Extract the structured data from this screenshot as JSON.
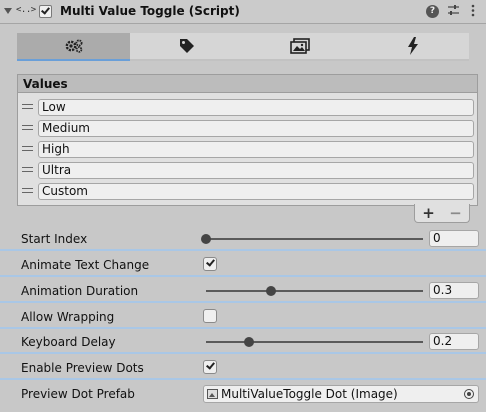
{
  "component": {
    "title": "Multi Value Toggle (Script)",
    "script_icon_text": "<..>",
    "enabled": true,
    "icons": {
      "help": "help-icon",
      "presets": "presets-icon",
      "menu": "kebab-menu-icon"
    }
  },
  "tabs": [
    {
      "icon": "gears-icon",
      "active": true
    },
    {
      "icon": "tag-icon",
      "active": false
    },
    {
      "icon": "images-icon",
      "active": false
    },
    {
      "icon": "lightning-icon",
      "active": false
    }
  ],
  "values_list": {
    "header": "Values",
    "items": [
      "Low",
      "Medium",
      "High",
      "Ultra",
      "Custom"
    ],
    "add_label": "+",
    "remove_label": "−"
  },
  "properties": {
    "start_index": {
      "label": "Start Index",
      "value": "0",
      "slider_fraction": 0.0
    },
    "animate_text_change": {
      "label": "Animate Text Change",
      "checked": true
    },
    "animation_duration": {
      "label": "Animation Duration",
      "value": "0.3",
      "slider_fraction": 0.3
    },
    "allow_wrapping": {
      "label": "Allow Wrapping",
      "checked": false
    },
    "keyboard_delay": {
      "label": "Keyboard Delay",
      "value": "0.2",
      "slider_fraction": 0.2
    },
    "enable_preview_dots": {
      "label": "Enable Preview Dots",
      "checked": true
    },
    "preview_dot_prefab": {
      "label": "Preview Dot Prefab",
      "value": "MultiValueToggle Dot (Image)"
    }
  },
  "colors": {
    "accent": "#6a9fd8",
    "separator": "#a9c7e6",
    "background": "#c8c8c8"
  }
}
